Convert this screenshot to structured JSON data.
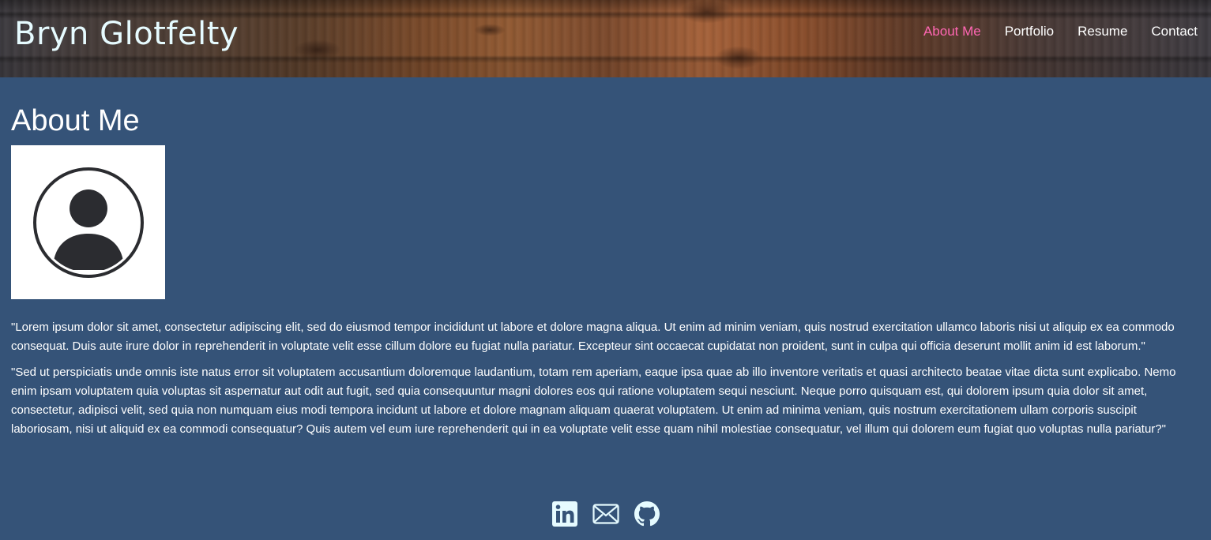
{
  "header": {
    "brand": "Bryn Glotfelty",
    "nav": [
      {
        "label": "About Me",
        "active": true
      },
      {
        "label": "Portfolio",
        "active": false
      },
      {
        "label": "Resume",
        "active": false
      },
      {
        "label": "Contact",
        "active": false
      }
    ]
  },
  "main": {
    "title": "About Me",
    "avatar_icon": "user-circle-icon",
    "paragraphs": [
      "\"Lorem ipsum dolor sit amet, consectetur adipiscing elit, sed do eiusmod tempor incididunt ut labore et dolore magna aliqua. Ut enim ad minim veniam, quis nostrud exercitation ullamco laboris nisi ut aliquip ex ea commodo consequat. Duis aute irure dolor in reprehenderit in voluptate velit esse cillum dolore eu fugiat nulla pariatur. Excepteur sint occaecat cupidatat non proident, sunt in culpa qui officia deserunt mollit anim id est laborum.\"",
      "\"Sed ut perspiciatis unde omnis iste natus error sit voluptatem accusantium doloremque laudantium, totam rem aperiam, eaque ipsa quae ab illo inventore veritatis et quasi architecto beatae vitae dicta sunt explicabo. Nemo enim ipsam voluptatem quia voluptas sit aspernatur aut odit aut fugit, sed quia consequuntur magni dolores eos qui ratione voluptatem sequi nesciunt. Neque porro quisquam est, qui dolorem ipsum quia dolor sit amet, consectetur, adipisci velit, sed quia non numquam eius modi tempora incidunt ut labore et dolore magnam aliquam quaerat voluptatem. Ut enim ad minima veniam, quis nostrum exercitationem ullam corporis suscipit laboriosam, nisi ut aliquid ex ea commodi consequatur? Quis autem vel eum iure reprehenderit qui in ea voluptate velit esse quam nihil molestiae consequatur, vel illum qui dolorem eum fugiat quo voluptas nulla pariatur?\""
    ]
  },
  "footer": {
    "socials": [
      "linkedin-icon",
      "email-icon",
      "github-icon"
    ]
  },
  "colors": {
    "background": "#355378",
    "brand_text": "#e6fbff",
    "nav_active": "#ff66b3",
    "icon": "#e6fbff"
  }
}
